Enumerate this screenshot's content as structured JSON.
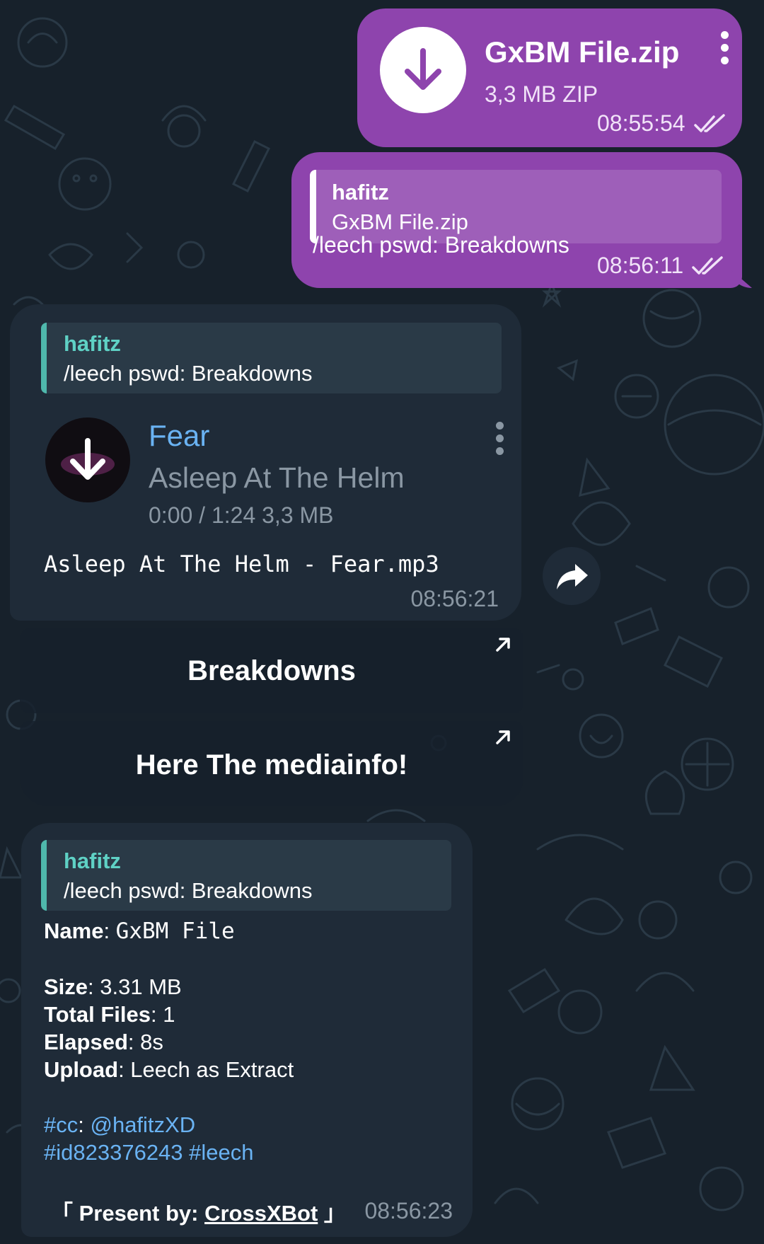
{
  "messages": {
    "file_out": {
      "file_name": "GxBM File.zip",
      "file_meta": "3,3 MB ZIP",
      "time": "08:55:54",
      "icon": "download-icon",
      "menu_icon": "more-vertical-icon"
    },
    "reply_out": {
      "reply_sender": "hafitz",
      "reply_text": "GxBM File.zip",
      "caption": "/leech pswd: Breakdowns",
      "time": "08:56:11"
    },
    "audio_in": {
      "reply_sender": "hafitz",
      "reply_text": "/leech pswd: Breakdowns",
      "title": "Fear",
      "artist": "Asleep At The Helm",
      "meta": "0:00 / 1:24 3,3 MB",
      "file_caption": "Asleep At The Helm - Fear.mp3",
      "time": "08:56:21"
    },
    "buttons": [
      {
        "label": "Breakdowns",
        "icon": "external-link-arrow-icon"
      },
      {
        "label": "Here The mediainfo!",
        "icon": "external-link-arrow-icon"
      }
    ],
    "info_in": {
      "reply_sender": "hafitz",
      "reply_text": "/leech pswd: Breakdowns",
      "name_label": "Name",
      "name_value": "GxBM File",
      "size_label": "Size",
      "size_value": "3.31 MB",
      "files_label": "Total Files",
      "files_value": "1",
      "elapsed_label": "Elapsed",
      "elapsed_value": "8s",
      "upload_label": "Upload",
      "upload_value": "Leech as Extract",
      "cc_tag": "#cc",
      "cc_user": "@hafitzXD",
      "id_tag": "#id823376243",
      "leech_tag": "#leech",
      "present_open": "「",
      "present_label": "Present by:",
      "present_link": "CrossXBot",
      "present_close": "」",
      "time": "08:56:23"
    }
  },
  "colors": {
    "background": "#17212b",
    "outgoing_bubble": "#8e44ad",
    "incoming_bubble": "#1f2b38",
    "accent_link": "#6ab3f3",
    "reply_accent": "#5fd1c5"
  }
}
